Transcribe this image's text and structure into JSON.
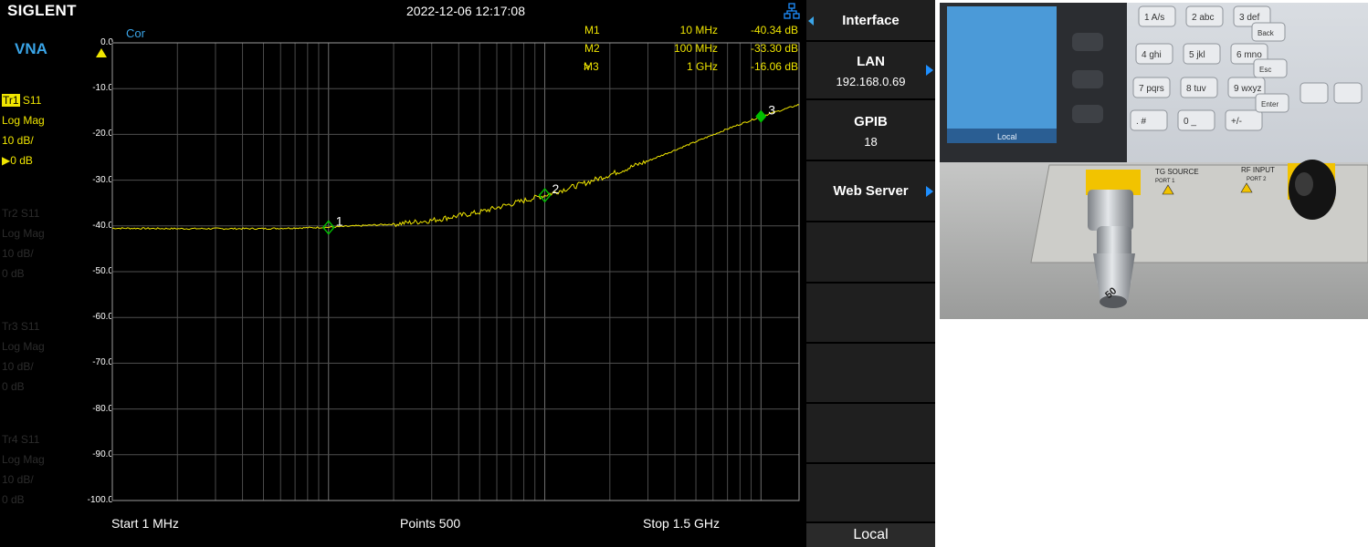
{
  "header": {
    "brand": "SIGLENT",
    "datetime": "2022-12-06 12:17:08"
  },
  "mode_label": "VNA",
  "traces": [
    {
      "tag": "Tr1",
      "param": "S11",
      "format": "Log Mag",
      "scale": "10 dB/",
      "ref": "0 dB",
      "active": true
    },
    {
      "tag": "Tr2",
      "param": "S11",
      "format": "Log Mag",
      "scale": "10 dB/",
      "ref": "0 dB",
      "active": false
    },
    {
      "tag": "Tr3",
      "param": "S11",
      "format": "Log Mag",
      "scale": "10 dB/",
      "ref": "0 dB",
      "active": false
    },
    {
      "tag": "Tr4",
      "param": "S11",
      "format": "Log Mag",
      "scale": "10 dB/",
      "ref": "0 dB",
      "active": false
    }
  ],
  "correction_label": "Cor",
  "markers": [
    {
      "id": "M1",
      "num": "1",
      "freq_label": "10 MHz",
      "value_label": "-40.34 dB",
      "freq_hz": 10000000,
      "value_db": -40.34,
      "active": false
    },
    {
      "id": "M2",
      "num": "2",
      "freq_label": "100 MHz",
      "value_label": "-33.30 dB",
      "freq_hz": 100000000,
      "value_db": -33.3,
      "active": false
    },
    {
      "id": "M3",
      "num": "3",
      "freq_label": "1 GHz",
      "value_label": "-16.06 dB",
      "freq_hz": 1000000000,
      "value_db": -16.06,
      "active": true
    }
  ],
  "active_marker_prefix": ">",
  "footer": {
    "start": "Start  1 MHz",
    "points": "Points  500",
    "stop": "Stop  1.5 GHz"
  },
  "softkeys": {
    "interface": "Interface",
    "lan_title": "LAN",
    "lan_ip": "192.168.0.69",
    "gpib_title": "GPIB",
    "gpib_addr": "18",
    "web_server": "Web Server",
    "local": "Local"
  },
  "photo": {
    "keys": [
      "1 A/s",
      "2 abc",
      "3 def",
      "4 ghi",
      "5 jkl",
      "6 mno",
      "7 pqrs",
      "8 tuv",
      "9 wxyz",
      ". #",
      "0 _",
      "+/-"
    ],
    "side_keys": [
      "Back",
      "Esc",
      "Enter"
    ],
    "screen_label": "Local",
    "port1_label": "TG SOURCE",
    "port1_sub": "PORT 1",
    "port2_label": "RF INPUT",
    "port2_sub": "PORT 2",
    "load_label": "50"
  },
  "colors": {
    "trace": "#f0e600",
    "accent_blue": "#3aa5e8",
    "marker_green": "#00c000",
    "grid": "#5a5a5a",
    "softkey_bg": "#1f1f1f"
  },
  "chart_data": {
    "type": "line",
    "x_scale": "log",
    "xlim_hz": [
      1000000,
      1500000000
    ],
    "ylim": [
      -100,
      0
    ],
    "yticks": [
      "0.0",
      "-10.0",
      "-20.0",
      "-30.0",
      "-40.0",
      "-50.0",
      "-60.0",
      "-70.0",
      "-80.0",
      "-90.0",
      "-100.0"
    ],
    "grid": true,
    "series": [
      {
        "x": [
          1000000,
          2000000,
          5000000,
          10000000,
          20000000,
          30000000,
          50000000,
          70000000,
          100000000,
          150000000,
          200000000,
          300000000,
          500000000,
          700000000,
          1000000000,
          1500000000
        ],
        "y": [
          -40.5,
          -40.6,
          -40.6,
          -40.3,
          -39.6,
          -38.8,
          -37,
          -35.2,
          -33.3,
          -30.8,
          -28.8,
          -25.8,
          -21.6,
          -18.8,
          -16.1,
          -13.5
        ]
      }
    ]
  }
}
